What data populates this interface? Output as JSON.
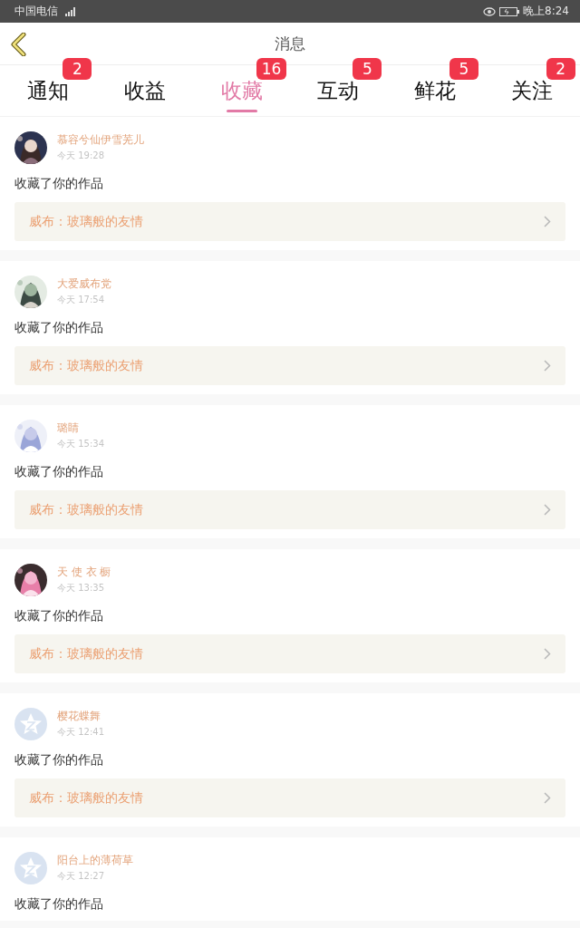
{
  "status_bar": {
    "carrier": "中国电信",
    "time": "晚上8:24"
  },
  "header": {
    "title": "消息"
  },
  "tabs": [
    {
      "label": "通知",
      "badge": "2",
      "selected": false
    },
    {
      "label": "收益",
      "selected": false
    },
    {
      "label": "收藏",
      "badge": "16",
      "selected": true
    },
    {
      "label": "互动",
      "badge": "5",
      "selected": false
    },
    {
      "label": "鲜花",
      "badge": "5",
      "selected": false
    },
    {
      "label": "关注",
      "badge": "2",
      "selected": false
    }
  ],
  "messages": [
    {
      "user": "慕容兮仙伊雪芜儿",
      "time": "今天 19:28",
      "kind": "picture",
      "text": "收藏了你的作品",
      "work": "威布：玻璃般的友情"
    },
    {
      "user": "大爱威布党",
      "time": "今天 17:54",
      "kind": "picture",
      "text": "收藏了你的作品",
      "work": "威布：玻璃般的友情"
    },
    {
      "user": "璐睛",
      "time": "今天 15:34",
      "kind": "picture",
      "text": "收藏了你的作品",
      "work": "威布：玻璃般的友情"
    },
    {
      "user": "天 使 衣 橱",
      "time": "今天 13:35",
      "kind": "picture",
      "text": "收藏了你的作品",
      "work": "威布：玻璃般的友情"
    },
    {
      "user": "樱花蝶舞",
      "time": "今天 12:41",
      "kind": "default",
      "text": "收藏了你的作品",
      "work": "威布：玻璃般的友情"
    },
    {
      "user": "阳台上的薄荷草",
      "time": "今天 12:27",
      "kind": "default",
      "text": "收藏了你的作品"
    }
  ]
}
